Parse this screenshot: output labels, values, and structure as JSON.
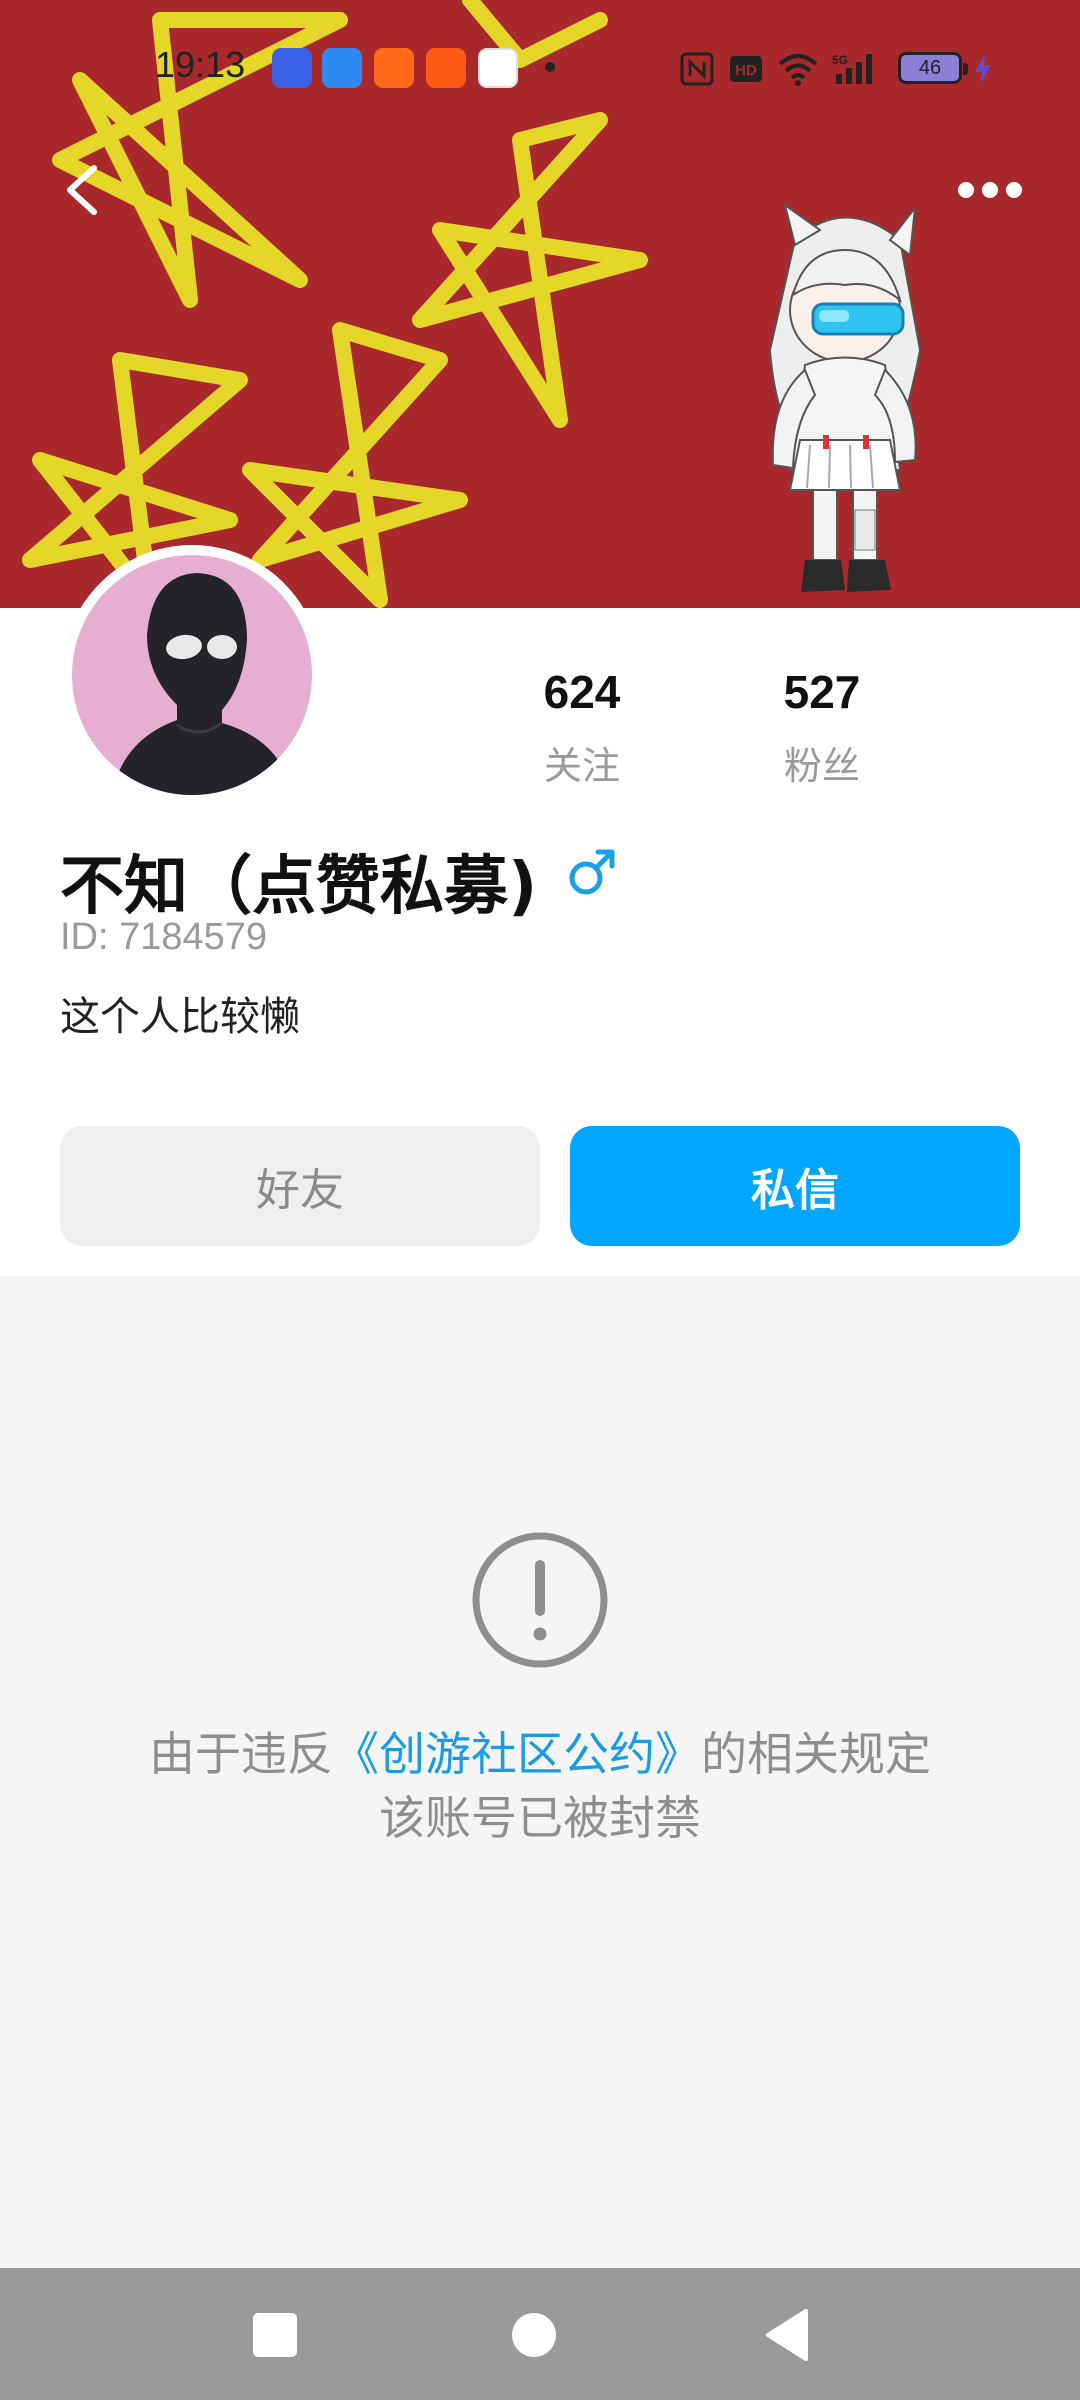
{
  "status_bar": {
    "time": "19:13",
    "battery_level": "46",
    "app_icons": [
      "baidu-icon",
      "cloud-drive-icon",
      "kuaishou-lite-icon",
      "kuaishou-icon",
      "game-icon"
    ],
    "system_icons": [
      "nfc-icon",
      "hd-icon",
      "wifi-icon",
      "5g-signal-icon",
      "battery-icon",
      "charging-icon"
    ]
  },
  "nav": {
    "back_icon": "chevron-left-icon",
    "more_icon": "more-dots-icon"
  },
  "profile": {
    "following_count": "624",
    "following_label": "关注",
    "followers_count": "527",
    "followers_label": "粉丝",
    "username": "不知（点赞私募)",
    "gender": "male",
    "user_id": "ID: 7184579",
    "bio": "这个人比较懒"
  },
  "actions": {
    "friend_label": "好友",
    "message_label": "私信"
  },
  "ban_notice": {
    "prefix": "由于违反",
    "link_text": "《创游社区公约》",
    "suffix": "的相关规定",
    "line2": "该账号已被封禁"
  },
  "colors": {
    "banner_bg": "#a8282c",
    "star_yellow": "#e8e028",
    "accent_blue": "#00a6ff",
    "link_blue": "#1a9be6",
    "gender_blue": "#1aa0e6"
  }
}
